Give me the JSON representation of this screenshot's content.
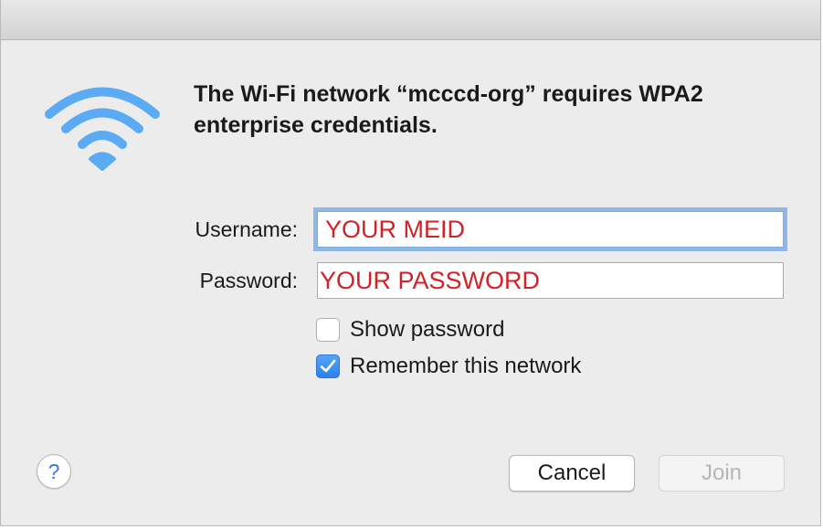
{
  "dialog": {
    "message": "The Wi-Fi network “mcccd-org” requires WPA2 enterprise credentials.",
    "icon": "wifi-icon",
    "accent_color": "#5aaaf4"
  },
  "form": {
    "username_label": "Username:",
    "username_value": "YOUR MEID",
    "password_label": "Password:",
    "password_value": "YOUR PASSWORD",
    "value_color": "#d42027"
  },
  "options": {
    "show_password_label": "Show password",
    "show_password_checked": false,
    "remember_label": "Remember this network",
    "remember_checked": true
  },
  "buttons": {
    "help_label": "?",
    "cancel_label": "Cancel",
    "join_label": "Join",
    "join_enabled": false
  }
}
